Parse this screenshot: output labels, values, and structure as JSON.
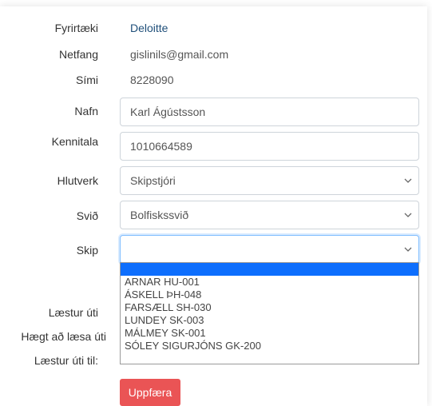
{
  "info": {
    "company_label": "Fyrirtæki",
    "company_value": "Deloitte",
    "email_label": "Netfang",
    "email_value": "gislinils@gmail.com",
    "phone_label": "Sími",
    "phone_value": "8228090"
  },
  "form": {
    "name_label": "Nafn",
    "name_value": "Karl Ágústsson",
    "kennitala_label": "Kennitala",
    "kennitala_value": "1010664589",
    "role_label": "Hlutverk",
    "role_value": "Skipstjóri",
    "division_label": "Svið",
    "division_value": "Bolfiskssvið",
    "ship_label": "Skip",
    "ship_value": "",
    "locked_out_label": "Læstur úti",
    "can_read_out_label": "Hægt að læsa úti",
    "locked_until_label": "Læstur úti til:",
    "submit_label": "Uppfæra"
  },
  "ship_options": [
    "",
    "ARNAR HU-001",
    "ÁSKELL ÞH-048",
    "FARSÆLL SH-030",
    "LUNDEY SK-003",
    "MÁLMEY SK-001",
    "SÓLEY SIGURJÓNS GK-200"
  ],
  "colors": {
    "link": "#1f4f7a",
    "button": "#ea5455",
    "selected_option": "#0d6efd"
  },
  "icons": {
    "chevron": "chevron-down-icon"
  }
}
